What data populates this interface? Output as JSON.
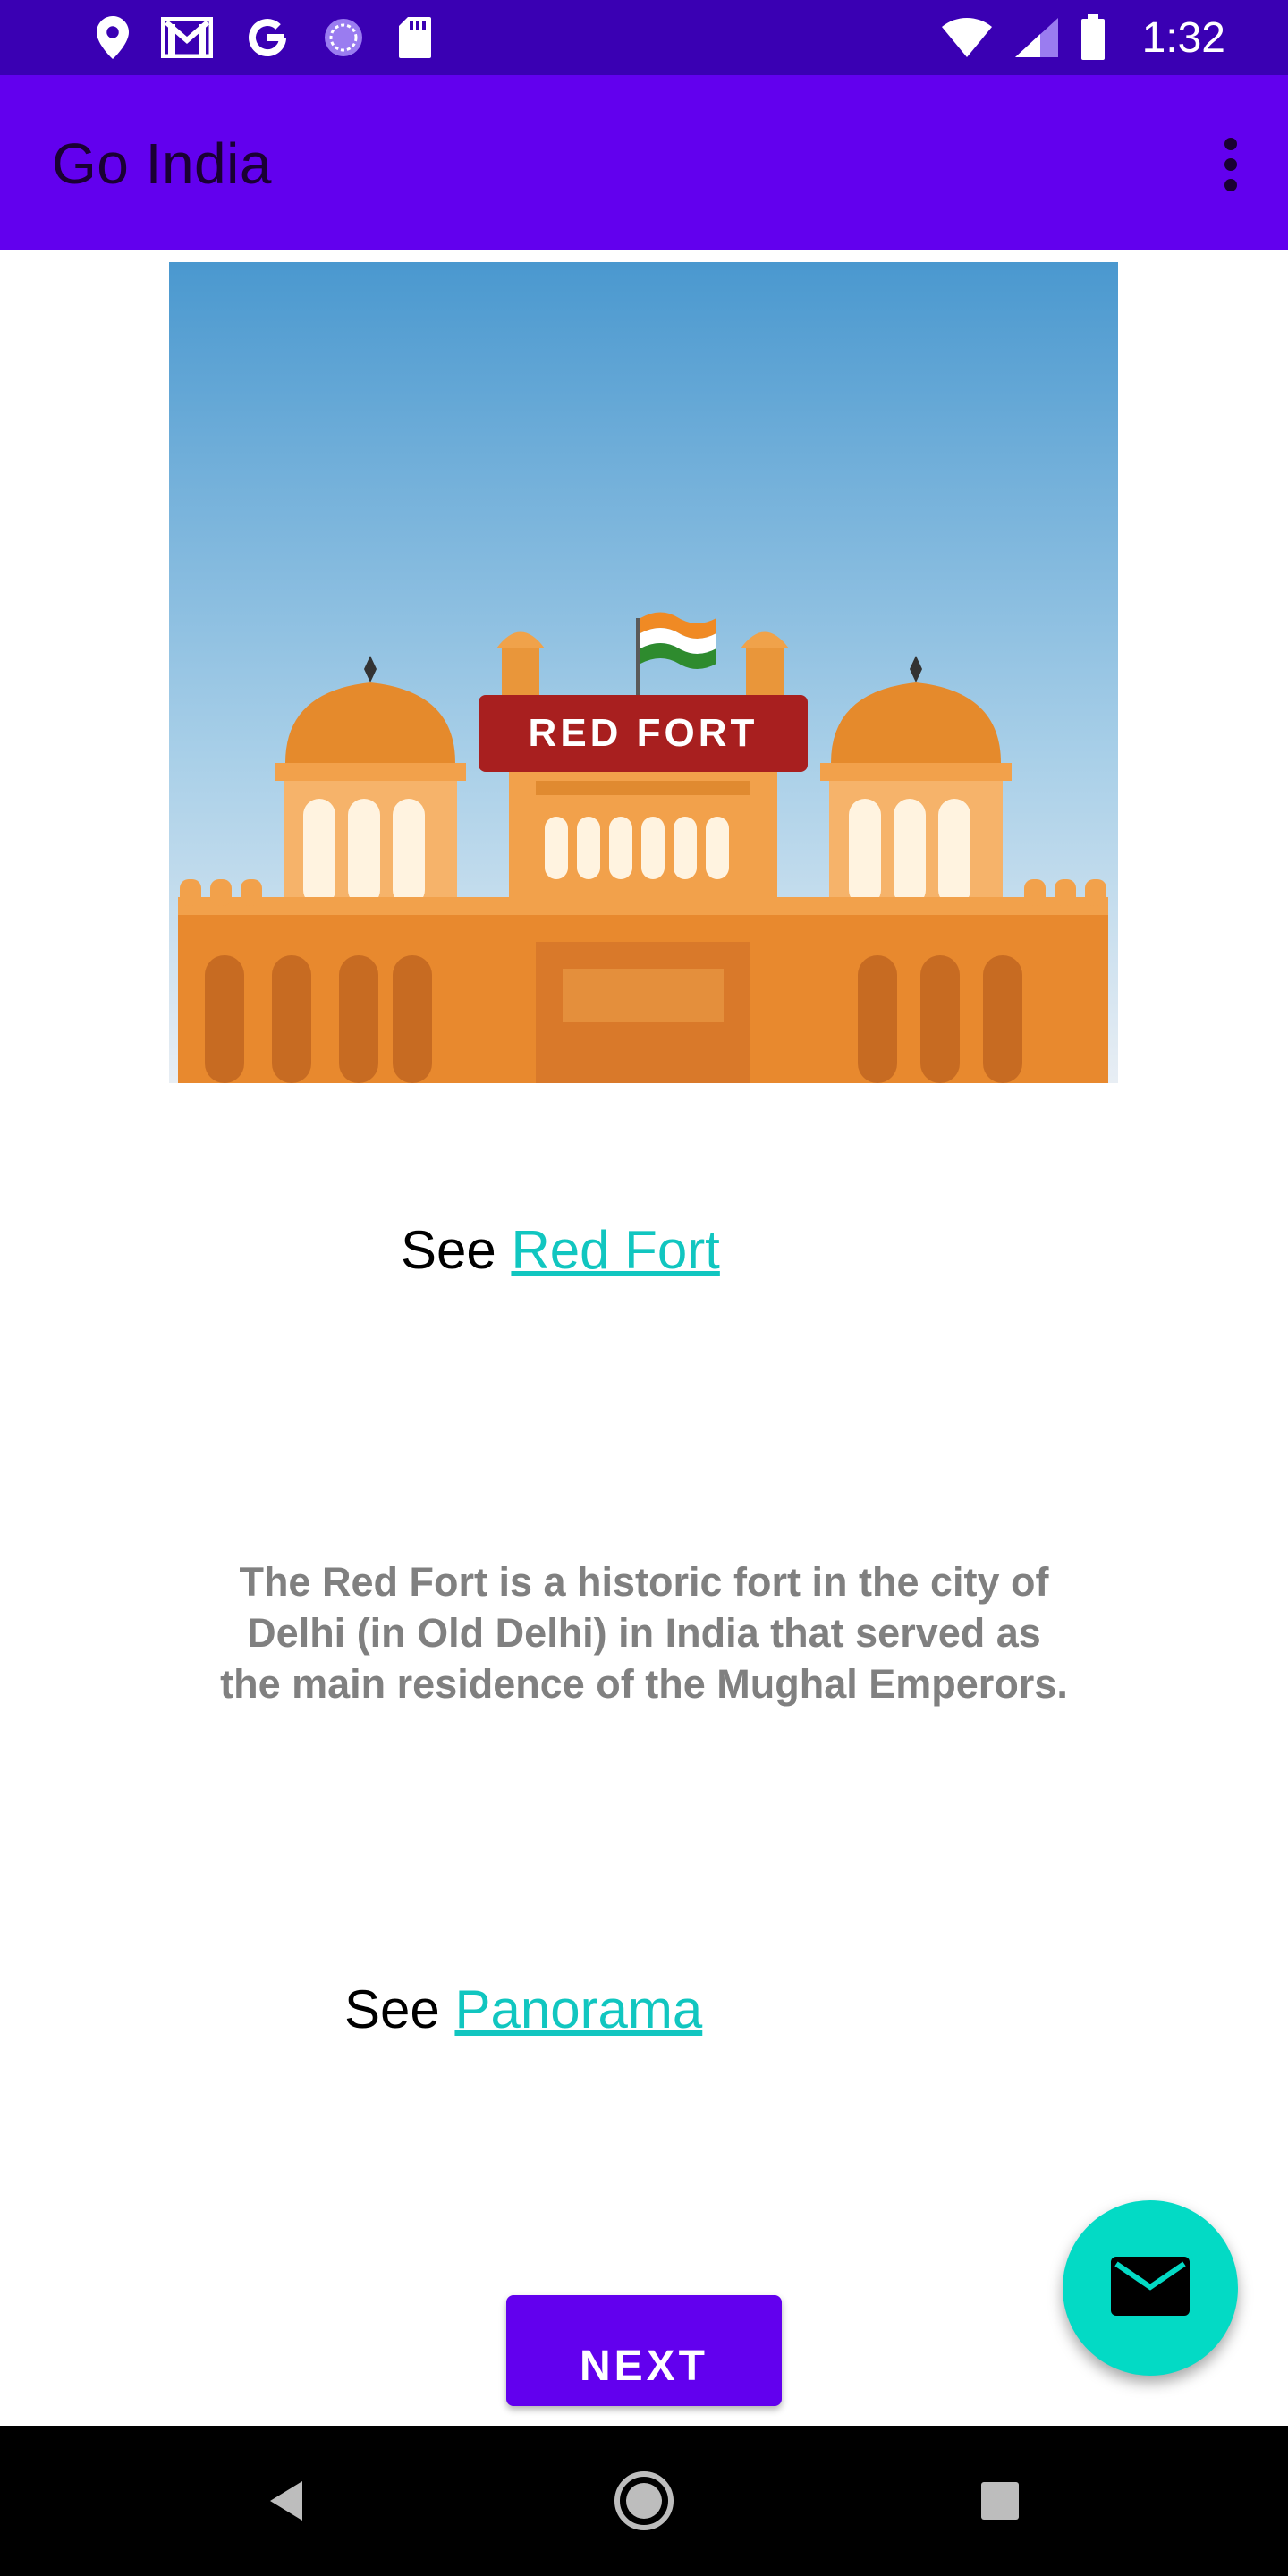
{
  "status_bar": {
    "time": "1:32",
    "left_icons": [
      "location-icon",
      "gmail-icon",
      "google-icon",
      "sync-icon",
      "sd-card-icon"
    ],
    "right_icons": [
      "wifi-icon",
      "signal-icon",
      "battery-icon"
    ]
  },
  "app_bar": {
    "title": "Go India",
    "menu_icon": "overflow-menu-icon"
  },
  "hero": {
    "label": "RED FORT"
  },
  "link_red_fort": {
    "prefix": "See",
    "link_text": "Red Fort"
  },
  "description": "The Red Fort is a historic fort in the city of Delhi (in Old Delhi) in India that served as the main residence of the Mughal Emperors.",
  "link_panorama": {
    "prefix": "See",
    "link_text": "Panorama"
  },
  "next_button": {
    "label": "NEXT"
  },
  "fab": {
    "icon": "email-icon"
  },
  "nav_bar": {
    "icons": [
      "back-icon",
      "home-icon",
      "recents-icon"
    ]
  },
  "colors": {
    "status_bar": "#3a00b3",
    "app_bar": "#6200ee",
    "link": "#11c6c0",
    "fab": "#03dac5",
    "description": "#808080"
  }
}
